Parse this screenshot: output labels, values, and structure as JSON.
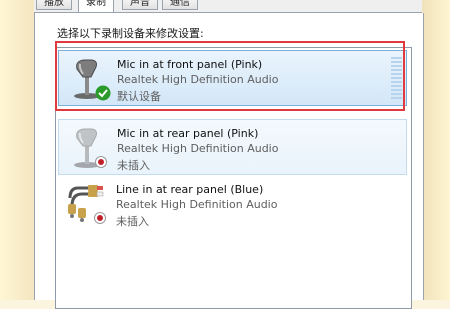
{
  "tabs": [
    {
      "label": "播放"
    },
    {
      "label": "录制"
    },
    {
      "label": "声音"
    },
    {
      "label": "通信"
    }
  ],
  "prompt": "选择以下录制设备来修改设置:",
  "devices": [
    {
      "name": "Mic in at front panel (Pink)",
      "driver": "Realtek High Definition Audio",
      "status": "默认设备",
      "icon": "microphone-icon",
      "badge": "default-check-icon"
    },
    {
      "name": "Mic in at rear panel (Pink)",
      "driver": "Realtek High Definition Audio",
      "status": "未插入",
      "icon": "microphone-icon",
      "badge": "unplugged-icon"
    },
    {
      "name": "Line in at rear panel (Blue)",
      "driver": "Realtek High Definition Audio",
      "status": "未插入",
      "icon": "audio-cable-icon",
      "badge": "unplugged-icon"
    }
  ],
  "colors": {
    "selection": "#d3e7f8",
    "highlight_box": "#e03a3e",
    "check": "#2a9a2a",
    "unplugged": "#c0202a"
  }
}
